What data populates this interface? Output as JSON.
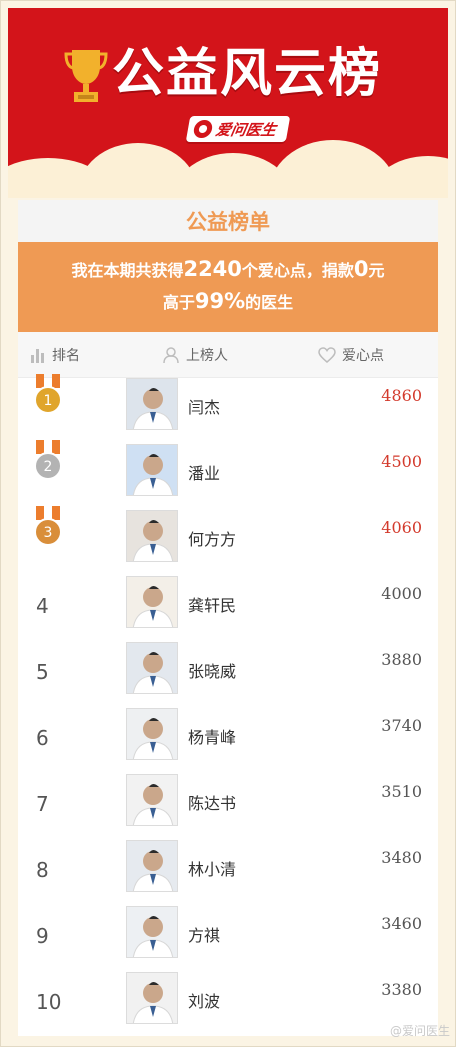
{
  "header": {
    "title": "公益风云榜",
    "brand": "爱问医生"
  },
  "card": {
    "heading": "公益榜单",
    "summary": {
      "prefix": "我在本期共获得",
      "points": "2240",
      "middle": "个爱心点，捐款",
      "donation": "0",
      "suffix": "元",
      "line2_prefix": "高于",
      "percent": "99%",
      "line2_suffix": "的医生"
    }
  },
  "columns": {
    "rank": "排名",
    "person": "上榜人",
    "points": "爱心点"
  },
  "doctors": [
    {
      "rank": "1",
      "name": "闫杰",
      "points": "4860",
      "top": true
    },
    {
      "rank": "2",
      "name": "潘业",
      "points": "4500",
      "top": true
    },
    {
      "rank": "3",
      "name": "何方方",
      "points": "4060",
      "top": true
    },
    {
      "rank": "4",
      "name": "龚轩民",
      "points": "4000",
      "top": false
    },
    {
      "rank": "5",
      "name": "张晓威",
      "points": "3880",
      "top": false
    },
    {
      "rank": "6",
      "name": "杨青峰",
      "points": "3740",
      "top": false
    },
    {
      "rank": "7",
      "name": "陈达书",
      "points": "3510",
      "top": false
    },
    {
      "rank": "8",
      "name": "林小清",
      "points": "3480",
      "top": false
    },
    {
      "rank": "9",
      "name": "方祺",
      "points": "3460",
      "top": false
    },
    {
      "rank": "10",
      "name": "刘波",
      "points": "3380",
      "top": false
    }
  ],
  "colors": {
    "banner_red": "#d3141a",
    "accent_orange": "#ef9a54",
    "top_points_red": "#d33a2c",
    "gold": "#e0a52c",
    "silver": "#b3b3b3",
    "bronze": "#d98e3a"
  },
  "icons": {
    "trophy": "trophy-icon",
    "rank": "bar-chart-icon",
    "person": "person-icon",
    "points": "heart-icon",
    "medal": "medal-icon"
  },
  "watermark": "@爱问医生"
}
